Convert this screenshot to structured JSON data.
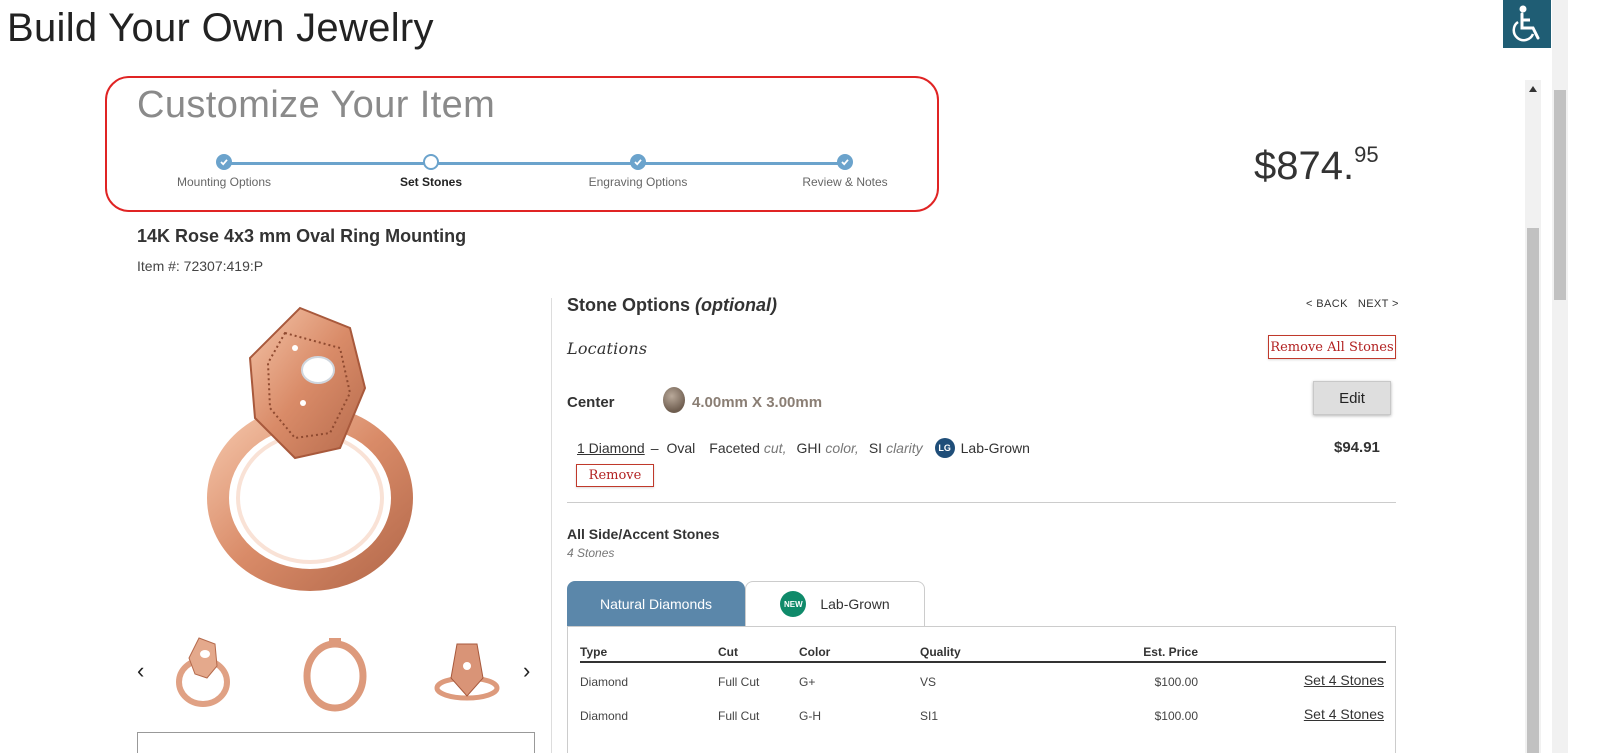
{
  "page": {
    "title": "Build Your Own Jewelry"
  },
  "customize": {
    "heading": "Customize Your Item",
    "steps": [
      {
        "label": "Mounting Options",
        "state": "complete"
      },
      {
        "label": "Set Stones",
        "state": "current"
      },
      {
        "label": "Engraving Options",
        "state": "complete"
      },
      {
        "label": "Review & Notes",
        "state": "complete"
      }
    ]
  },
  "price": {
    "whole": "$874.",
    "cents": "95"
  },
  "product": {
    "title": "14K Rose 4x3 mm Oval Ring Mounting",
    "item_number": "Item #: 72307:419:P"
  },
  "stone_options": {
    "title": "Stone Options",
    "title_suffix": "(optional)",
    "back": "< BACK",
    "next": "NEXT >",
    "locations": "Locations",
    "remove_all": "Remove All Stones",
    "center": {
      "label": "Center",
      "size": "4.00mm X 3.00mm",
      "edit": "Edit",
      "stone_link": "1 Diamond",
      "dash": "–",
      "shape": "Oval",
      "cut_value": "Faceted",
      "cut_label": "cut,",
      "color_value": "GHI",
      "color_label": "color,",
      "clarity_value": "SI",
      "clarity_label": "clarity",
      "lg_badge": "LG",
      "lab_grown": "Lab-Grown",
      "price": "$94.91",
      "remove": "Remove"
    },
    "accent": {
      "title": "All Side/Accent Stones",
      "subtitle": "4 Stones"
    },
    "tabs": {
      "natural": "Natural Diamonds",
      "new_badge": "NEW",
      "lab": "Lab-Grown"
    },
    "table": {
      "headers": {
        "type": "Type",
        "cut": "Cut",
        "color": "Color",
        "quality": "Quality",
        "price": "Est. Price"
      },
      "rows": [
        {
          "type": "Diamond",
          "cut": "Full Cut",
          "color": "G+",
          "quality": "VS",
          "price": "$100.00",
          "action": "Set 4 Stones"
        },
        {
          "type": "Diamond",
          "cut": "Full Cut",
          "color": "G-H",
          "quality": "SI1",
          "price": "$100.00",
          "action": "Set 4 Stones"
        }
      ]
    }
  },
  "colors": {
    "accent_blue": "#6ba3cc",
    "tab_blue": "#5b87aa",
    "remove_red": "#b22222",
    "highlight_red": "#e02424",
    "a11y_teal": "#1f5d74"
  },
  "icons": {
    "accessibility": "wheelchair-icon",
    "prev": "chevron-left-icon",
    "next": "chevron-right-icon",
    "check": "check-icon"
  }
}
